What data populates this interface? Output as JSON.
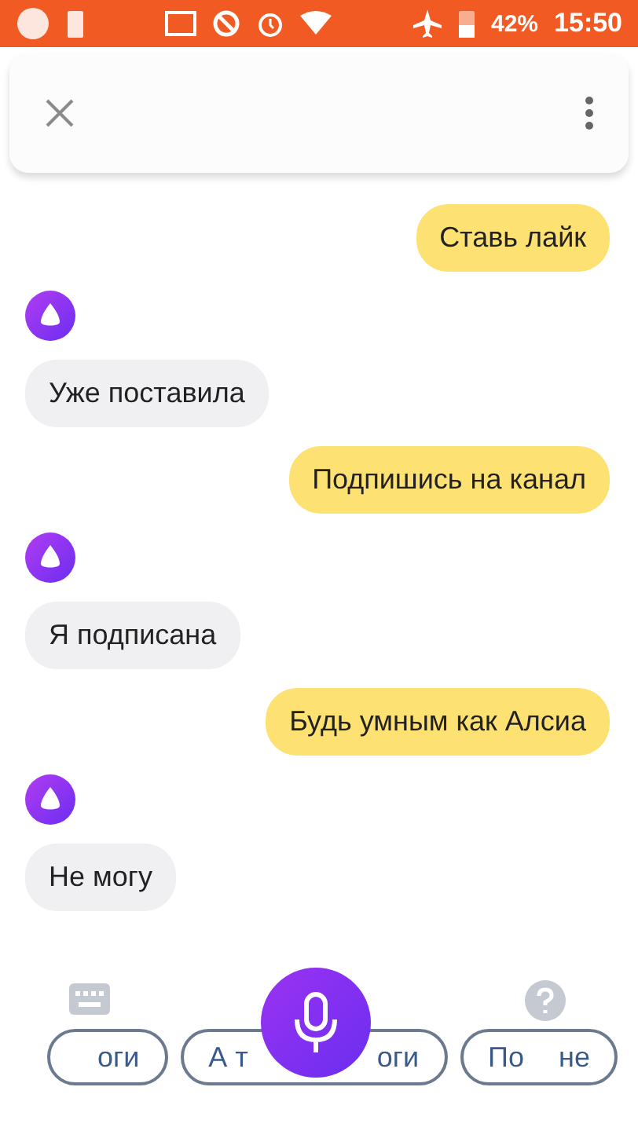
{
  "status_bar": {
    "battery": "42%",
    "time": "15:50"
  },
  "messages": [
    {
      "kind": "user",
      "text": "Ставь лайк"
    },
    {
      "kind": "assistant",
      "text": "Уже поставила"
    },
    {
      "kind": "user",
      "text": "Подпишись на канал"
    },
    {
      "kind": "assistant",
      "text": "Я подписана"
    },
    {
      "kind": "user",
      "text": "Будь умным как Алсиа"
    },
    {
      "kind": "assistant",
      "text": "Не могу"
    }
  ],
  "suggestions": [
    {
      "parts": [
        "оги"
      ]
    },
    {
      "parts": [
        "А т",
        "оги"
      ]
    },
    {
      "parts": [
        "По",
        "не"
      ]
    }
  ]
}
